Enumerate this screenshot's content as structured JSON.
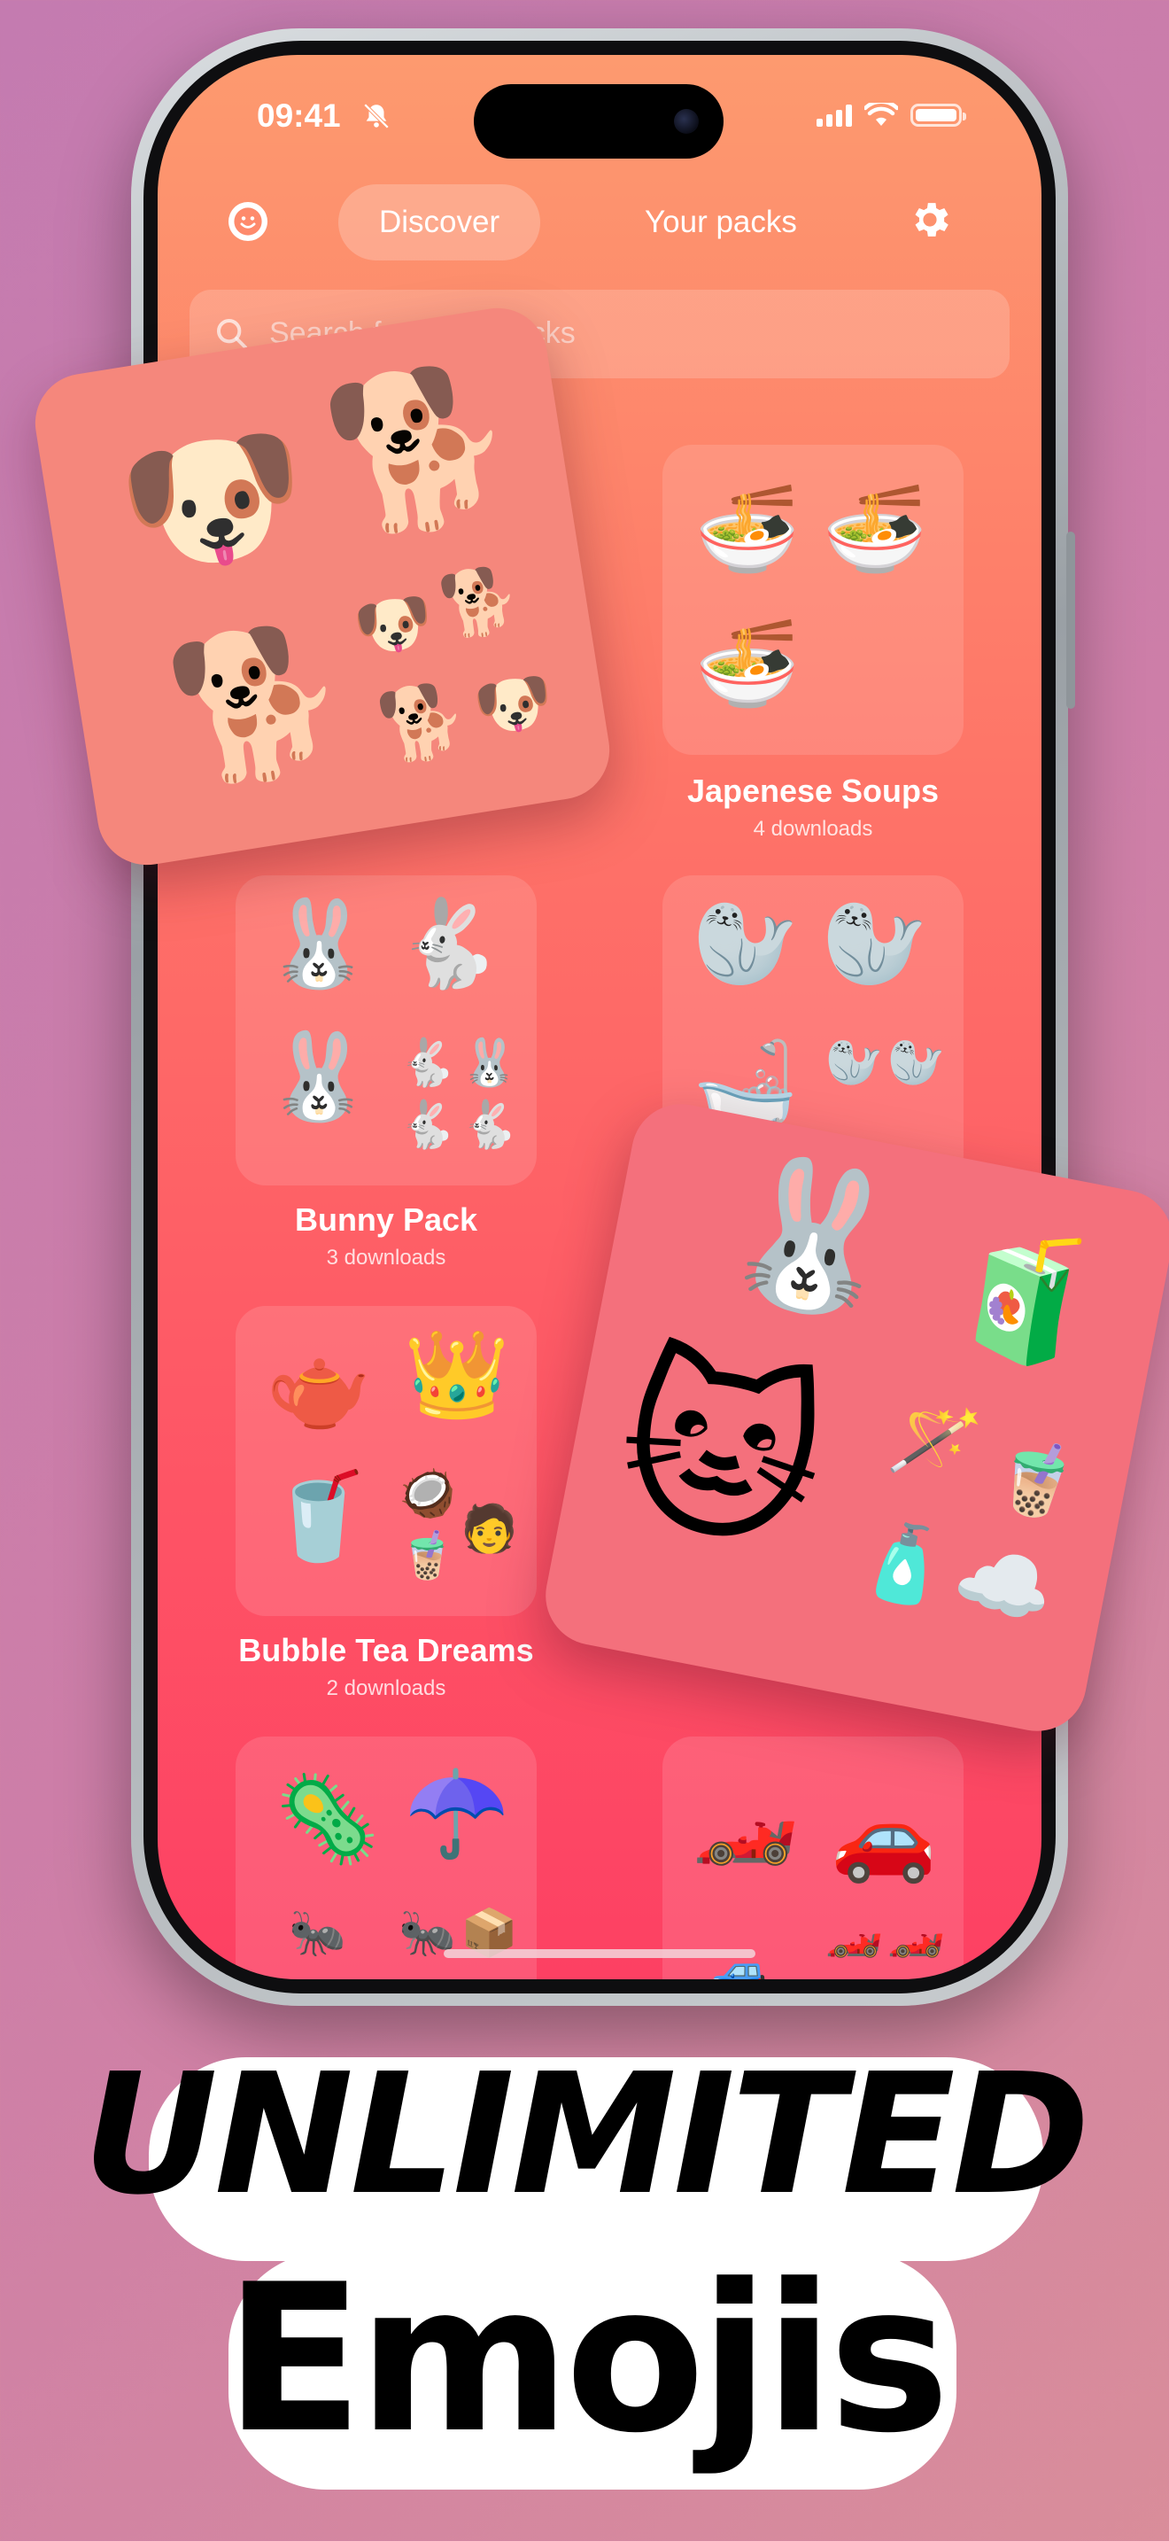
{
  "status_bar": {
    "time": "09:41"
  },
  "nav": {
    "tabs": [
      {
        "label": "Discover",
        "active": true
      },
      {
        "label": "Your packs",
        "active": false
      }
    ]
  },
  "search": {
    "placeholder": "Search for emoji packs"
  },
  "packs": [
    {
      "title": "",
      "downloads": "",
      "emojis": [
        "🐶",
        "🐕",
        "🐕",
        "🐶",
        "🐕",
        "🐕",
        "🐶"
      ]
    },
    {
      "title": "Japenese Soups",
      "downloads": "4 downloads",
      "emojis": [
        "🍜",
        "🍜",
        "🍜"
      ]
    },
    {
      "title": "Bunny Pack",
      "downloads": "3 downloads",
      "emojis": [
        "🐰",
        "🐇",
        "🐰",
        "🐇",
        "🐰",
        "🐇",
        "🐇"
      ]
    },
    {
      "title": "",
      "downloads": "",
      "emojis": [
        "🦭",
        "🦭",
        "🛁",
        "🦭",
        "🦭",
        "🦭",
        "🦭"
      ]
    },
    {
      "title": "Bubble Tea Dreams",
      "downloads": "2 downloads",
      "emojis": [
        "🫖",
        "👑",
        "🥤",
        "🥥",
        "🧋",
        "🧑"
      ]
    },
    {
      "title": "",
      "downloads": "",
      "emojis": [
        "🦠",
        "☂️",
        "🐜",
        "🐜",
        "📦"
      ]
    },
    {
      "title": "",
      "downloads": "",
      "emojis": [
        "🏎️",
        "🚗",
        "🏎️",
        "🏎️",
        "🚙"
      ]
    }
  ],
  "floating_cards": [
    {
      "emojis": [
        "🐶",
        "🐕",
        "🐕",
        "🐶",
        "🐕",
        "🐕",
        "🐶"
      ]
    },
    {
      "emojis": [
        "🐰",
        "🧃",
        "🐱",
        "🪄",
        "🧋",
        "🧴",
        "☁️"
      ]
    }
  ],
  "headline": {
    "line1": "UNLIMITED",
    "line2": "Emojis"
  }
}
